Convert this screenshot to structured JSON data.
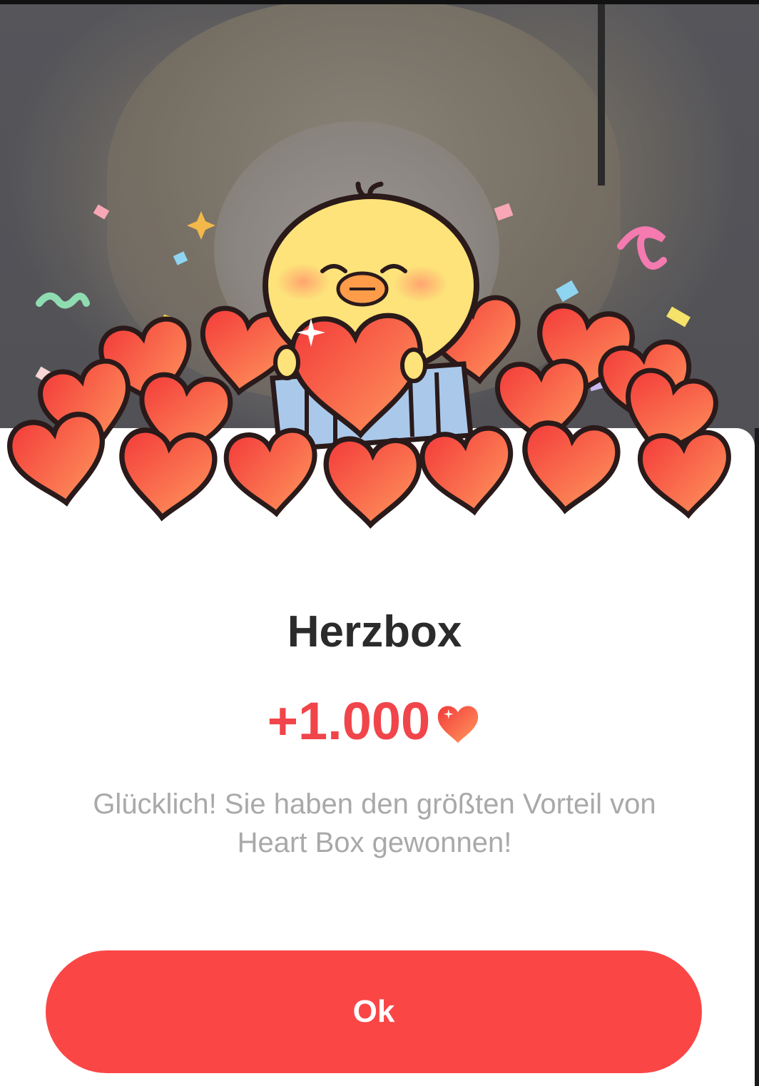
{
  "dialog": {
    "title": "Herzbox",
    "amount": "+1.000",
    "amount_icon": "heart-icon",
    "message": "Glücklich! Sie haben den größten Vorteil von Heart Box gewonnen!",
    "ok_label": "Ok"
  },
  "illustration": {
    "subject": "chick-holding-heart-icon",
    "decor": [
      "heart-pile",
      "confetti"
    ]
  },
  "colors": {
    "accent": "#fb4646",
    "amount_text": "#f0454a",
    "title_text": "#2b2b2b",
    "message_text": "#a9a9a9",
    "heart_light": "#ff8a5c",
    "heart_dark": "#f33a3a",
    "chick": "#fde37a"
  }
}
